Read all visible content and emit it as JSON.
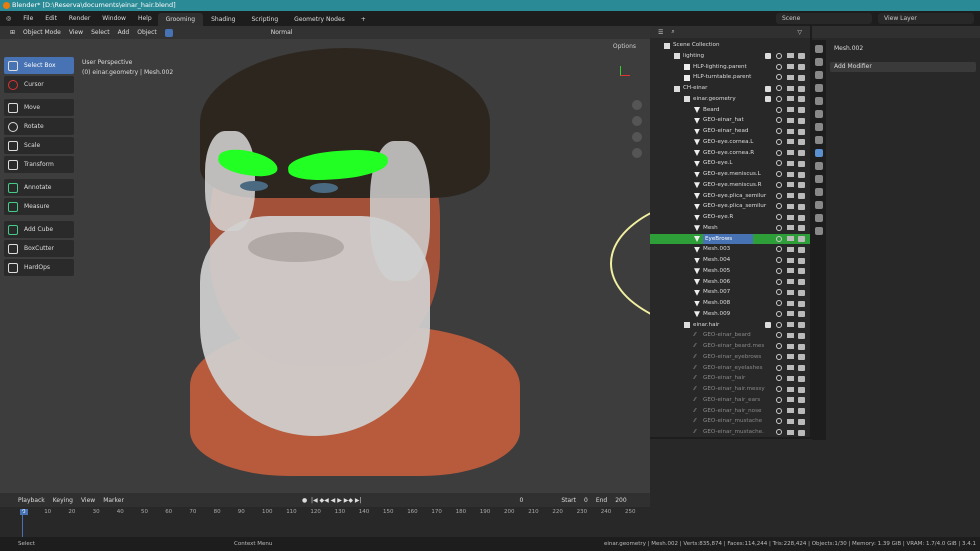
{
  "title": "Blender* [D:\\Reserva\\documents\\einar_hair.blend]",
  "menu": [
    "File",
    "Edit",
    "Render",
    "Window",
    "Help"
  ],
  "workspaces": [
    {
      "label": "Grooming",
      "active": true
    },
    {
      "label": "Shading"
    },
    {
      "label": "Scripting"
    },
    {
      "label": "Geometry Nodes"
    },
    {
      "label": "+"
    }
  ],
  "scene": "Scene",
  "view_layer": "View Layer",
  "viewport": {
    "mode": "Object Mode",
    "menus": [
      "View",
      "Select",
      "Add",
      "Object"
    ],
    "shading": "Normal",
    "perspective": "User Perspective",
    "object_info": "(0) einar.geometry | Mesh.002",
    "options": "Options"
  },
  "tools": [
    "Select Box",
    "Cursor",
    "Move",
    "Rotate",
    "Scale",
    "Transform",
    "Annotate",
    "Measure",
    "Add Cube",
    "BoxCutter",
    "HardOps"
  ],
  "outliner": {
    "rows": [
      {
        "label": "Scene Collection",
        "indent": 0,
        "type": "collection"
      },
      {
        "label": "lighting",
        "indent": 1,
        "type": "collection",
        "check": true
      },
      {
        "label": "HLP-lighting.parent",
        "indent": 2,
        "type": "empty"
      },
      {
        "label": "HLP-turntable.parent",
        "indent": 2,
        "type": "empty"
      },
      {
        "label": "CH-einar",
        "indent": 1,
        "type": "collection",
        "check": true
      },
      {
        "label": "einar.geometry",
        "indent": 2,
        "type": "collection",
        "check": true
      },
      {
        "label": "Beard",
        "indent": 3,
        "type": "mesh"
      },
      {
        "label": "GEO-einar_hat",
        "indent": 3,
        "type": "mesh"
      },
      {
        "label": "GEO-einar_head",
        "indent": 3,
        "type": "mesh"
      },
      {
        "label": "GEO-eye.cornea.L",
        "indent": 3,
        "type": "mesh"
      },
      {
        "label": "GEO-eye.cornea.R",
        "indent": 3,
        "type": "mesh"
      },
      {
        "label": "GEO-eye.L",
        "indent": 3,
        "type": "mesh"
      },
      {
        "label": "GEO-eye.meniscus.L",
        "indent": 3,
        "type": "mesh"
      },
      {
        "label": "GEO-eye.meniscus.R",
        "indent": 3,
        "type": "mesh"
      },
      {
        "label": "GEO-eye.plica_semilur",
        "indent": 3,
        "type": "mesh"
      },
      {
        "label": "GEO-eye.plica_semilur",
        "indent": 3,
        "type": "mesh"
      },
      {
        "label": "GEO-eye.R",
        "indent": 3,
        "type": "mesh"
      },
      {
        "label": "Mesh",
        "indent": 3,
        "type": "mesh"
      },
      {
        "label": "EyeBrows",
        "indent": 3,
        "type": "mesh",
        "selected": true
      },
      {
        "label": "Mesh.003",
        "indent": 3,
        "type": "mesh"
      },
      {
        "label": "Mesh.004",
        "indent": 3,
        "type": "mesh"
      },
      {
        "label": "Mesh.005",
        "indent": 3,
        "type": "mesh"
      },
      {
        "label": "Mesh.006",
        "indent": 3,
        "type": "mesh"
      },
      {
        "label": "Mesh.007",
        "indent": 3,
        "type": "mesh"
      },
      {
        "label": "Mesh.008",
        "indent": 3,
        "type": "mesh"
      },
      {
        "label": "Mesh.009",
        "indent": 3,
        "type": "mesh"
      },
      {
        "label": "einar.hair",
        "indent": 2,
        "type": "collection",
        "check": true
      },
      {
        "label": "GEO-einar_beard",
        "indent": 3,
        "type": "hair",
        "dim": true
      },
      {
        "label": "GEO-einar_beard.mes",
        "indent": 3,
        "type": "hair",
        "dim": true
      },
      {
        "label": "GEO-einar_eyebrows",
        "indent": 3,
        "type": "hair",
        "dim": true
      },
      {
        "label": "GEO-einar_eyelashes",
        "indent": 3,
        "type": "hair",
        "dim": true
      },
      {
        "label": "GEO-einar_hair",
        "indent": 3,
        "type": "hair",
        "dim": true
      },
      {
        "label": "GEO-einar_hair.messy",
        "indent": 3,
        "type": "hair",
        "dim": true
      },
      {
        "label": "GEO-einar_hair_ears",
        "indent": 3,
        "type": "hair",
        "dim": true
      },
      {
        "label": "GEO-einar_hair_nose",
        "indent": 3,
        "type": "hair",
        "dim": true
      },
      {
        "label": "GEO-einar_mustache",
        "indent": 3,
        "type": "hair",
        "dim": true
      },
      {
        "label": "GEO-einar_mustache.",
        "indent": 3,
        "type": "hair",
        "dim": true
      }
    ]
  },
  "properties": {
    "object": "Mesh.002",
    "add_modifier": "Add Modifier"
  },
  "timeline": {
    "menus": [
      "Playback",
      "Keying",
      "View",
      "Marker"
    ],
    "current": "0",
    "start_label": "Start",
    "start": "0",
    "end_label": "End",
    "end": "200",
    "ticks": [
      "0",
      "10",
      "20",
      "30",
      "40",
      "50",
      "60",
      "70",
      "80",
      "90",
      "100",
      "110",
      "120",
      "130",
      "140",
      "150",
      "160",
      "170",
      "180",
      "190",
      "200",
      "210",
      "220",
      "230",
      "240",
      "250"
    ]
  },
  "status": {
    "left": "Select",
    "mid": "Context Menu",
    "right": "einar.geometry | Mesh.002 | Verts:835,874 | Faces:114,244 | Tris:228,424 | Objects:1/30 | Memory: 1.39 GiB | VRAM: 1.7/4.0 GiB | 3.4.1"
  },
  "colors": {
    "accent": "#4772b3",
    "selected_row": "#2e9f38",
    "eyebrows": "#22ff22"
  }
}
